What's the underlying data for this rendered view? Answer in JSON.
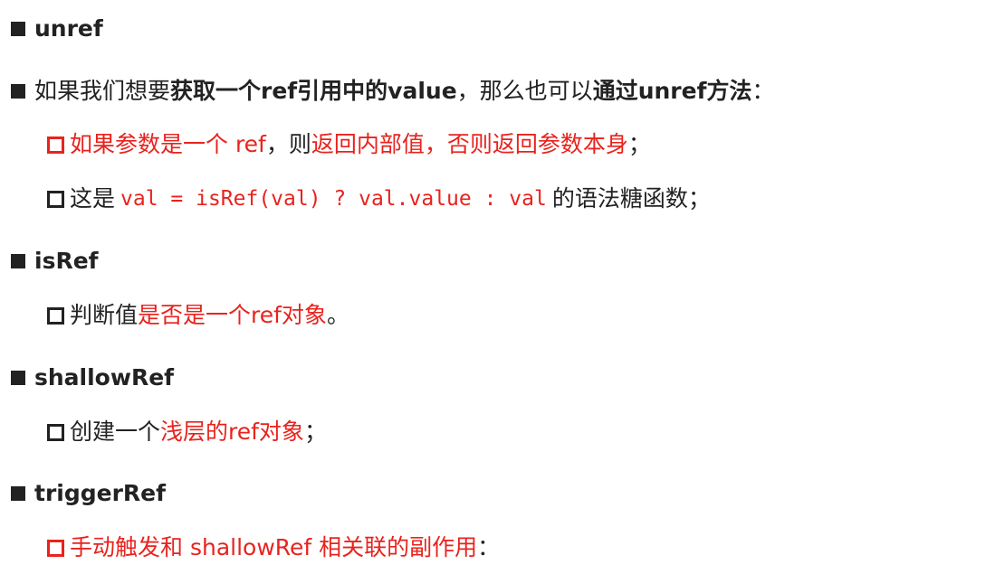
{
  "sections": [
    {
      "heading": "unref",
      "intro": {
        "part1": "如果我们想要",
        "part2": "获取一个ref引用中的value",
        "part3": "，那么也可以",
        "part4": "通过unref方法",
        "part5": "："
      },
      "items": [
        {
          "part1": "如果参数是一个 ref",
          "part2": "，则",
          "part3": "返回内部值",
          "part4": "，",
          "part5": "否则返回参数本身",
          "part6": "；"
        },
        {
          "part1": "这是",
          "code": "val = isRef(val) ? val.value : val",
          "part2": "的语法糖函数；"
        }
      ]
    },
    {
      "heading": "isRef",
      "items": [
        {
          "part1": "判断值",
          "part2": "是否是一个ref对象",
          "part3": "。"
        }
      ]
    },
    {
      "heading": "shallowRef",
      "items": [
        {
          "part1": "创建一个",
          "part2": "浅层的ref对象",
          "part3": "；"
        }
      ]
    },
    {
      "heading": "triggerRef",
      "items": [
        {
          "part1": "手动触发和 shallowRef 相关联的副作用",
          "part2": "："
        }
      ]
    }
  ],
  "colors": {
    "text": "#222222",
    "accent": "#e8231e"
  }
}
